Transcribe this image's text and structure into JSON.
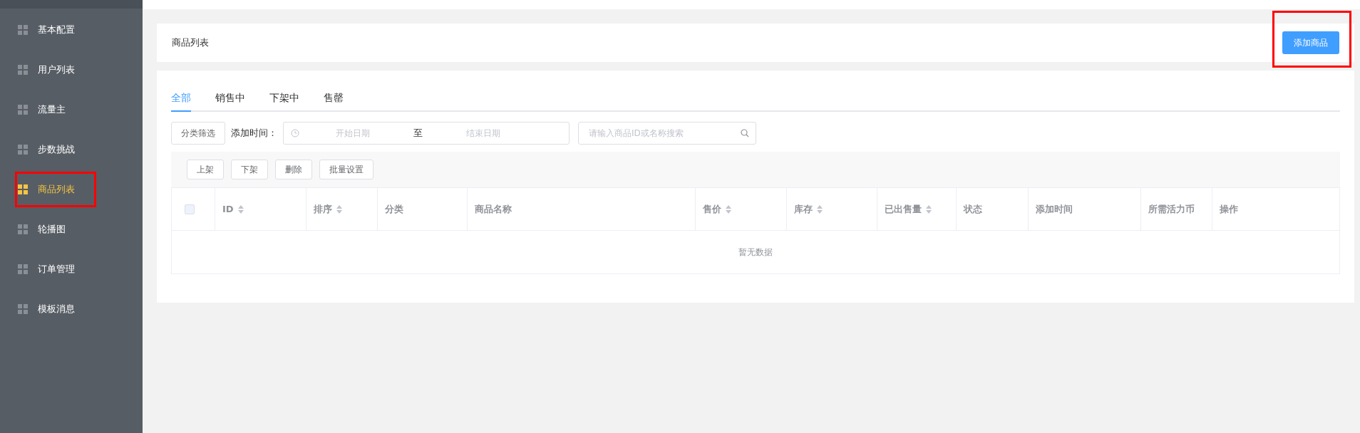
{
  "sidebar": {
    "items": [
      {
        "label": "基本配置",
        "selected": false,
        "highlighted": false
      },
      {
        "label": "用户列表",
        "selected": false,
        "highlighted": false
      },
      {
        "label": "流量主",
        "selected": false,
        "highlighted": false
      },
      {
        "label": "步数挑战",
        "selected": false,
        "highlighted": false
      },
      {
        "label": "商品列表",
        "selected": true,
        "highlighted": true
      },
      {
        "label": "轮播图",
        "selected": false,
        "highlighted": false
      },
      {
        "label": "订单管理",
        "selected": false,
        "highlighted": false
      },
      {
        "label": "模板消息",
        "selected": false,
        "highlighted": false
      }
    ]
  },
  "header": {
    "title": "商品列表",
    "add_button": {
      "label": "添加商品",
      "highlighted": true
    }
  },
  "tabs": [
    {
      "label": "全部",
      "selected": true
    },
    {
      "label": "销售中",
      "selected": false
    },
    {
      "label": "下架中",
      "selected": false
    },
    {
      "label": "售罄",
      "selected": false
    }
  ],
  "filters": {
    "category_button": "分类筛选",
    "date_label": "添加时间：",
    "start_placeholder": "开始日期",
    "separator": "至",
    "end_placeholder": "结束日期",
    "search_placeholder": "请输入商品ID或名称搜索"
  },
  "actions": [
    "上架",
    "下架",
    "删除",
    "批量设置"
  ],
  "table": {
    "select_all_checked": false,
    "columns": [
      {
        "label": "ID",
        "sortable": true
      },
      {
        "label": "排序",
        "sortable": true
      },
      {
        "label": "分类",
        "sortable": false
      },
      {
        "label": "商品名称",
        "sortable": false
      },
      {
        "label": "售价",
        "sortable": true
      },
      {
        "label": "库存",
        "sortable": true
      },
      {
        "label": "已出售量",
        "sortable": true
      },
      {
        "label": "状态",
        "sortable": false
      },
      {
        "label": "添加时间",
        "sortable": false
      },
      {
        "label": "所需活力币",
        "sortable": false
      },
      {
        "label": "操作",
        "sortable": false
      }
    ],
    "empty_text": "暂无数据"
  }
}
